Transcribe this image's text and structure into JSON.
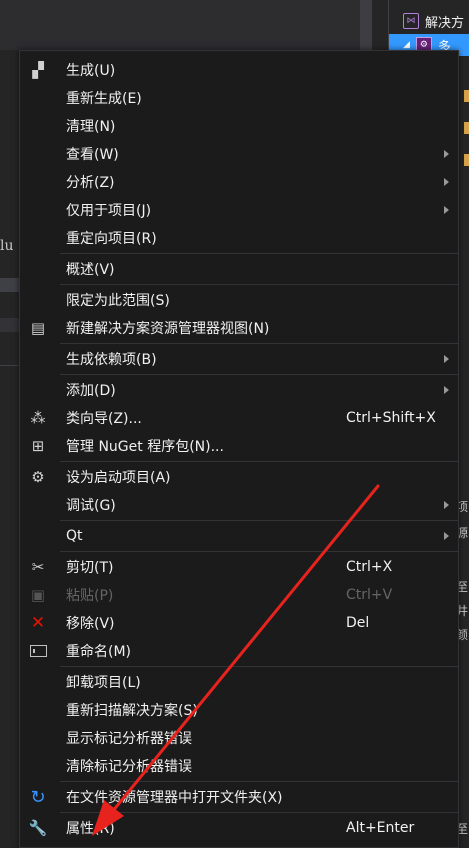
{
  "background": {
    "left_text": "lu",
    "solution_explorer": {
      "solution_label": "解决方",
      "project_label": "多"
    }
  },
  "menu": {
    "items": [
      {
        "id": "build",
        "label": "生成(U)",
        "icon": "build-icon"
      },
      {
        "id": "rebuild",
        "label": "重新生成(E)"
      },
      {
        "id": "clean",
        "label": "清理(N)"
      },
      {
        "id": "view",
        "label": "查看(W)",
        "submenu": true
      },
      {
        "id": "analyze",
        "label": "分析(Z)",
        "submenu": true
      },
      {
        "id": "project-only",
        "label": "仅用于项目(J)",
        "submenu": true
      },
      {
        "id": "retarget",
        "label": "重定向项目(R)"
      },
      {
        "id": "overview",
        "label": "概述(V)"
      },
      {
        "id": "scope-to-this",
        "label": "限定为此范围(S)"
      },
      {
        "id": "new-explorer-view",
        "label": "新建解决方案资源管理器视图(N)",
        "icon": "new-view-icon"
      },
      {
        "id": "build-dependencies",
        "label": "生成依赖项(B)",
        "submenu": true
      },
      {
        "id": "add",
        "label": "添加(D)",
        "submenu": true
      },
      {
        "id": "class-wizard",
        "label": "类向导(Z)...",
        "shortcut": "Ctrl+Shift+X",
        "icon": "class-wizard-icon"
      },
      {
        "id": "manage-nuget",
        "label": "管理 NuGet 程序包(N)...",
        "icon": "nuget-package-icon"
      },
      {
        "id": "set-startup",
        "label": "设为启动项目(A)",
        "icon": "gear-icon"
      },
      {
        "id": "debug",
        "label": "调试(G)",
        "submenu": true
      },
      {
        "id": "qt",
        "label": "Qt",
        "submenu": true
      },
      {
        "id": "cut",
        "label": "剪切(T)",
        "shortcut": "Ctrl+X",
        "icon": "scissors-icon"
      },
      {
        "id": "paste",
        "label": "粘贴(P)",
        "shortcut": "Ctrl+V",
        "icon": "clipboard-icon",
        "disabled": true
      },
      {
        "id": "remove",
        "label": "移除(V)",
        "shortcut": "Del",
        "icon": "remove-x-icon"
      },
      {
        "id": "rename",
        "label": "重命名(M)",
        "icon": "rename-icon"
      },
      {
        "id": "unload",
        "label": "卸载项目(L)"
      },
      {
        "id": "rescan",
        "label": "重新扫描解决方案(S)"
      },
      {
        "id": "show-analyzer-errors",
        "label": "显示标记分析器错误"
      },
      {
        "id": "clear-analyzer-errors",
        "label": "清除标记分析器错误"
      },
      {
        "id": "open-in-explorer",
        "label": "在文件资源管理器中打开文件夹(X)",
        "icon": "refresh-arrow-icon"
      },
      {
        "id": "properties",
        "label": "属性(R)",
        "shortcut": "Alt+Enter",
        "icon": "wrench-icon"
      }
    ]
  },
  "annotation": {
    "color": "#e8231d"
  }
}
